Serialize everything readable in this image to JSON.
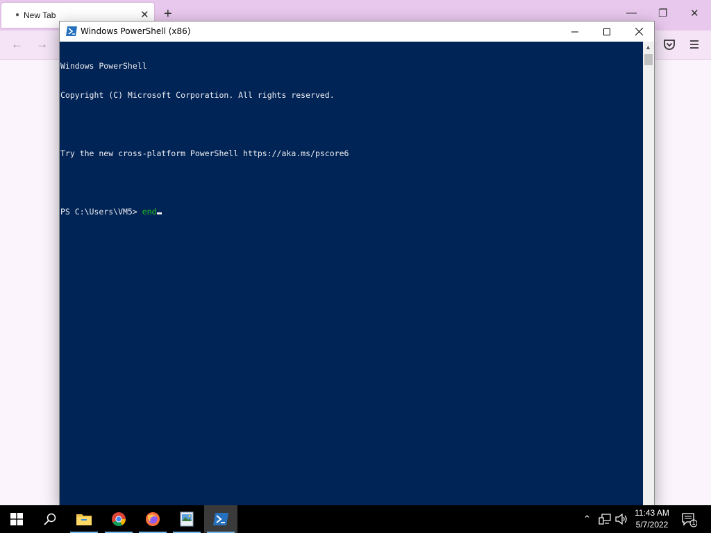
{
  "browser": {
    "tab_label": "New Tab",
    "tab_close": "✕",
    "new_tab": "+",
    "back": "←",
    "forward": "→"
  },
  "window": {
    "title": "Windows PowerShell (x86)"
  },
  "console": {
    "lines": [
      "Windows PowerShell",
      "Copyright (C) Microsoft Corporation. All rights reserved.",
      "",
      "Try the new cross-platform PowerShell https://aka.ms/pscore6",
      ""
    ],
    "prompt": "PS C:\\Users\\VM5> ",
    "command": "end"
  },
  "taskbar": {
    "apps": [
      "start-icon",
      "search-icon",
      "file-explorer-icon",
      "chrome-icon",
      "firefox-icon",
      "photos-icon",
      "powershell-icon"
    ],
    "active_app": "powershell-icon",
    "time": "11:43 AM",
    "date": "5/7/2022",
    "notification_count": "1"
  },
  "colors": {
    "console_bg": "#012456",
    "console_fg": "#eeedf0",
    "command_fg": "#20c020",
    "browser_tabbar": "#e9c8ee"
  }
}
